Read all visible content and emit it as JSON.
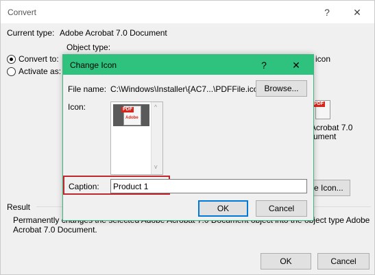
{
  "convert": {
    "title": "Convert",
    "help_glyph": "?",
    "close_glyph": "✕",
    "current_type_label": "Current type:",
    "current_type_value": "Adobe Acrobat 7.0 Document",
    "object_type_label": "Object type:",
    "convert_to_label": "Convert to:",
    "activate_as_label": "Activate as:",
    "display_as_icon_label": "icon",
    "icon_caption_line1": "Acrobat 7.0",
    "icon_caption_line2": "ument",
    "change_icon_button": "ge Icon...",
    "result_label": "Result",
    "result_text_line1": "Permanently changes the selected Adobe Acrobat 7.0 Document object into the object type Adobe",
    "result_text_line2": "Acrobat 7.0 Document.",
    "ok_label": "OK",
    "cancel_label": "Cancel"
  },
  "change_icon": {
    "title": "Change Icon",
    "help_glyph": "?",
    "close_glyph": "✕",
    "file_name_label": "File name:",
    "file_name_value": "C:\\Windows\\Installer\\{AC7...\\PDFFile.ico",
    "browse_label": "Browse...",
    "icon_label": "Icon:",
    "caption_label": "Caption:",
    "caption_value": "Product 1",
    "ok_label": "OK",
    "cancel_label": "Cancel",
    "icon_badge": "PDF",
    "icon_text": "Adobe"
  },
  "colors": {
    "change_icon_titlebar": "#2ec27e",
    "caption_highlight": "#c0262e",
    "default_button_border": "#0078d7"
  }
}
